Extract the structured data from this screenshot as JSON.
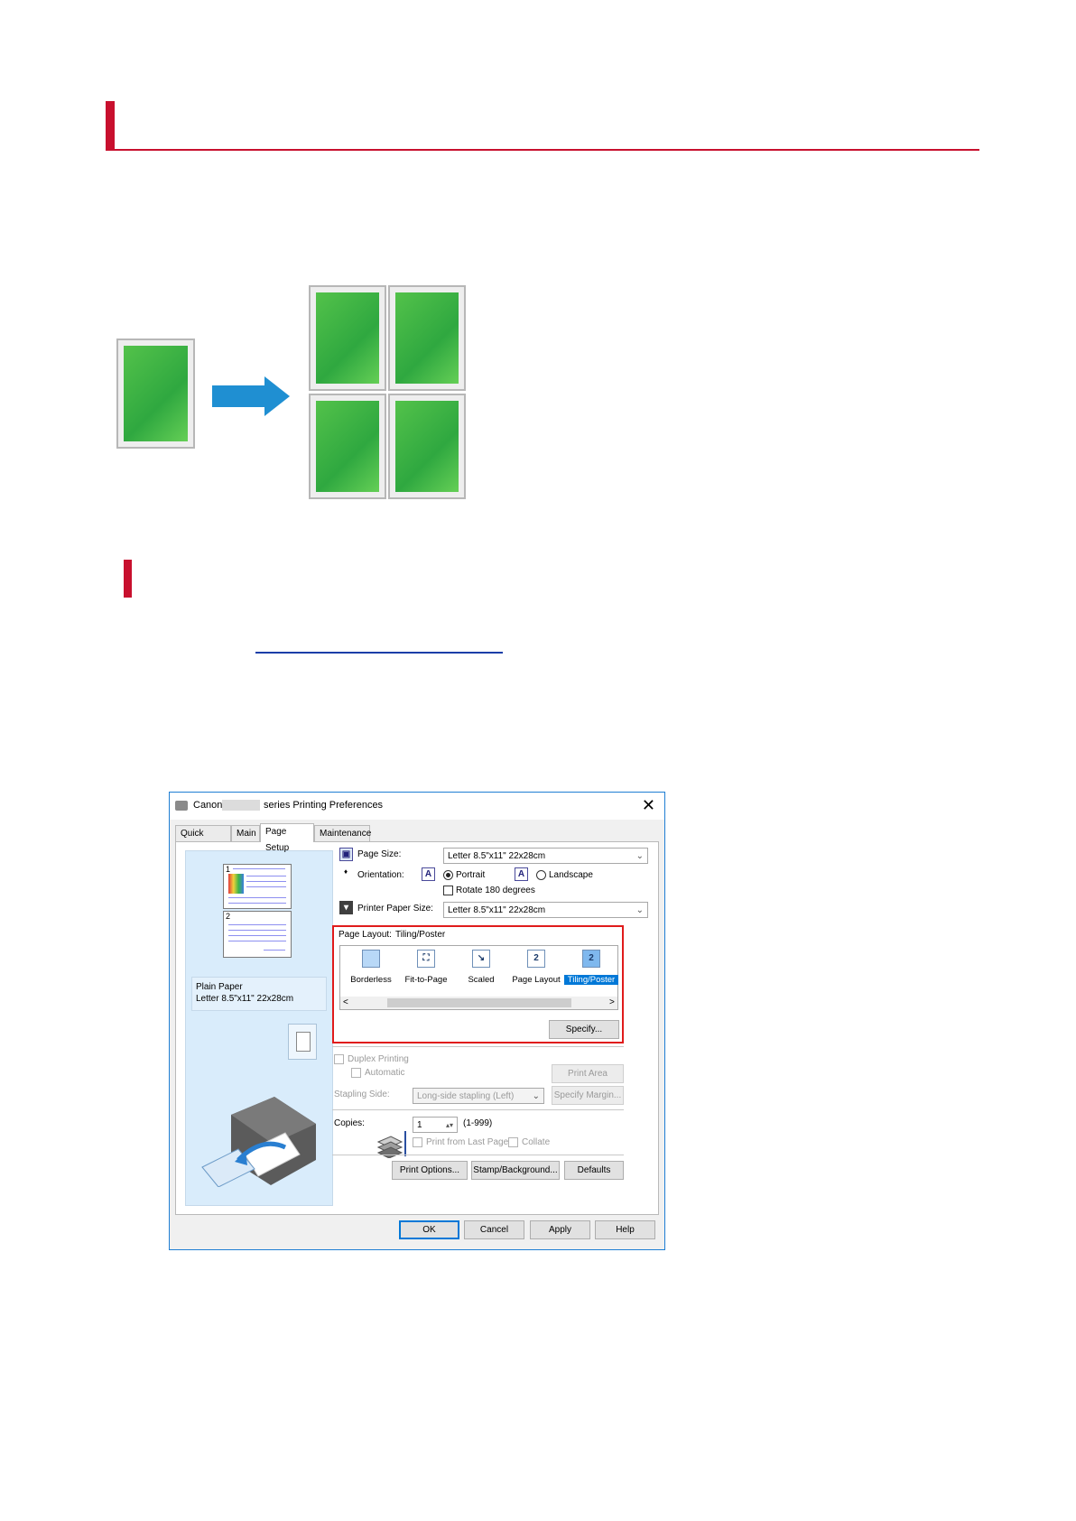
{
  "dialog": {
    "title_prefix": "Canon",
    "title_suffix": "series Printing Preferences",
    "close": "✕",
    "tabs": [
      "Quick Setup",
      "Main",
      "Page Setup",
      "Maintenance"
    ],
    "active_tab": "Page Setup",
    "preview": {
      "page1_number": "1",
      "page2_number": "2",
      "paper_type": "Plain Paper",
      "paper_size": "Letter 8.5\"x11\" 22x28cm"
    },
    "page_size": {
      "label": "Page Size:",
      "value": "Letter 8.5\"x11\" 22x28cm"
    },
    "orientation": {
      "label": "Orientation:",
      "portrait": "Portrait",
      "landscape": "Landscape",
      "selected": "Portrait",
      "rotate": "Rotate 180 degrees",
      "icon_glyph": "A"
    },
    "printer_paper_size": {
      "label": "Printer Paper Size:",
      "value": "Letter 8.5\"x11\" 22x28cm"
    },
    "page_layout": {
      "label": "Page Layout:",
      "value": "Tiling/Poster",
      "items": [
        "Borderless",
        "Fit-to-Page",
        "Scaled",
        "Page Layout",
        "Tiling/Poster"
      ],
      "selected": "Tiling/Poster",
      "specify": "Specify...",
      "scroll_left": "<",
      "scroll_right": ">"
    },
    "duplex": {
      "label": "Duplex Printing",
      "automatic": "Automatic",
      "print_area_setup": "Print Area Setup..."
    },
    "stapling": {
      "label": "Stapling Side:",
      "value": "Long-side stapling (Left)",
      "specify_margin": "Specify Margin..."
    },
    "copies": {
      "label": "Copies:",
      "value": "1",
      "range": "(1-999)",
      "print_from_last": "Print from Last Page",
      "collate": "Collate"
    },
    "buttons": {
      "print_options": "Print Options...",
      "stamp_background": "Stamp/Background...",
      "defaults": "Defaults",
      "ok": "OK",
      "cancel": "Cancel",
      "apply": "Apply",
      "help": "Help"
    }
  },
  "colors": {
    "heading_accent": "#c8102e",
    "link": "#1a3ea8",
    "arrow": "#1f8fd2",
    "highlight_box": "#e01b1b",
    "selection": "#0078d7"
  }
}
